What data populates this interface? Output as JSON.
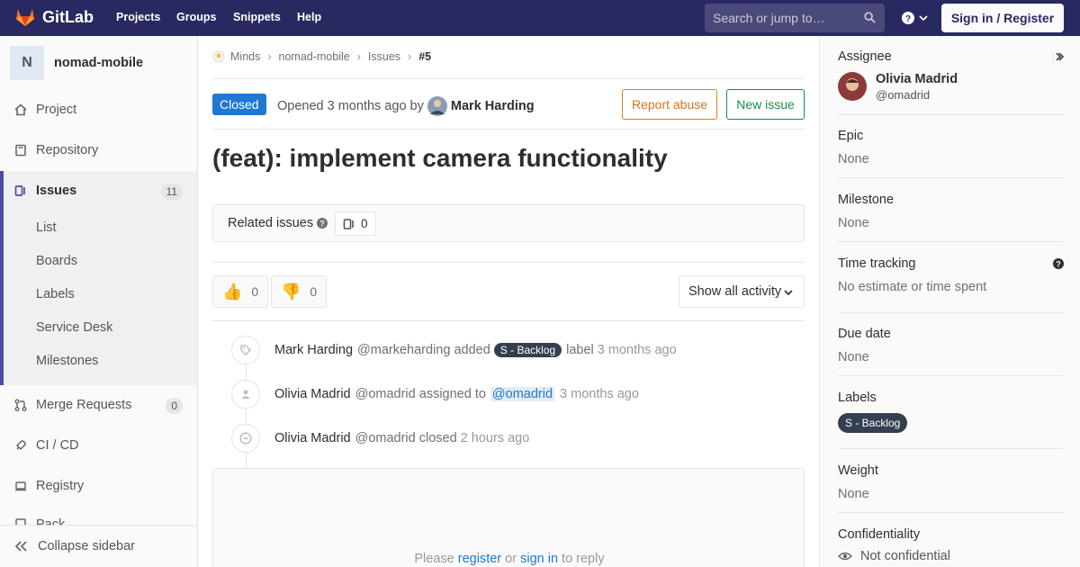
{
  "topbar": {
    "brand": "GitLab",
    "nav": [
      "Projects",
      "Groups",
      "Snippets",
      "Help"
    ],
    "search_placeholder": "Search or jump to…",
    "signin_label": "Sign in / Register"
  },
  "sidebar": {
    "project_initial": "N",
    "project_name": "nomad-mobile",
    "items": {
      "project": "Project",
      "repository": "Repository",
      "issues": "Issues",
      "issues_count": "11",
      "merge_requests": "Merge Requests",
      "merge_requests_count": "0",
      "ci_cd": "CI / CD",
      "registry": "Registry",
      "packages_partial": "Pack"
    },
    "issues_sub": [
      "List",
      "Boards",
      "Labels",
      "Service Desk",
      "Milestones"
    ],
    "collapse_label": "Collapse sidebar"
  },
  "breadcrumb": [
    "Minds",
    "nomad-mobile",
    "Issues",
    "#5"
  ],
  "issue": {
    "status": "Closed",
    "opened_prefix": "Opened",
    "opened_time": "3 months ago",
    "by": "by",
    "author": "Mark Harding",
    "report_abuse_label": "Report abuse",
    "new_issue_label": "New issue",
    "title": "(feat): implement camera functionality",
    "related_label": "Related issues",
    "related_count": "0",
    "thumbs_up": "0",
    "thumbs_down": "0",
    "activity_filter": "Show all activity"
  },
  "timeline": [
    {
      "name": "Mark Harding",
      "handle": "@markeharding",
      "action": "added",
      "label": "S - Backlog",
      "suffix": "label",
      "time": "3 months ago"
    },
    {
      "name": "Olivia Madrid",
      "handle": "@omadrid",
      "action": "assigned to",
      "mention": "@omadrid",
      "time": "3 months ago"
    },
    {
      "name": "Olivia Madrid",
      "handle": "@omadrid",
      "action": "closed",
      "time": "2 hours ago"
    }
  ],
  "reply": {
    "please": "Please",
    "register": "register",
    "or": "or",
    "signin": "sign in",
    "suffix": "to reply"
  },
  "right_sidebar": {
    "assignee_label": "Assignee",
    "assignee_name": "Olivia Madrid",
    "assignee_handle": "@omadrid",
    "epic_label": "Epic",
    "epic_value": "None",
    "milestone_label": "Milestone",
    "milestone_value": "None",
    "time_tracking_label": "Time tracking",
    "time_tracking_value": "No estimate or time spent",
    "due_date_label": "Due date",
    "due_date_value": "None",
    "labels_label": "Labels",
    "label_pill": "S - Backlog",
    "weight_label": "Weight",
    "weight_value": "None",
    "confidentiality_label": "Confidentiality",
    "confidentiality_value": "Not confidential"
  },
  "colors": {
    "nav_bg": "#292961",
    "accent_blue": "#1f78d1",
    "abuse_orange": "#e67e22",
    "new_green": "#168f48",
    "label_dark": "#344050"
  }
}
